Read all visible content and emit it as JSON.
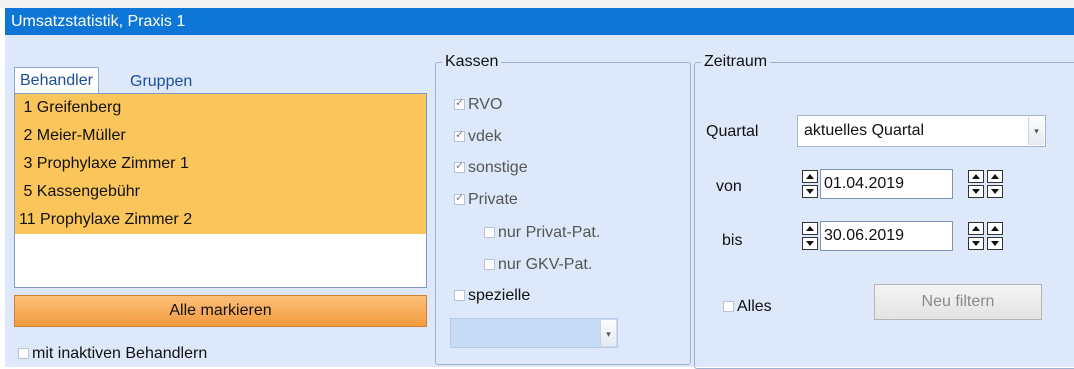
{
  "window": {
    "title": "Umsatzstatistik, Praxis 1"
  },
  "behandler": {
    "tabs": [
      "Behandler",
      "Gruppen"
    ],
    "items": [
      " 1 Greifenberg",
      " 2 Meier-Müller",
      " 3 Prophylaxe Zimmer 1",
      " 5 Kassengebühr",
      "11 Prophylaxe Zimmer 2"
    ],
    "select_all_label": "Alle markieren",
    "inactive_label": "mit inaktiven Behandlern"
  },
  "kassen": {
    "title": "Kassen",
    "options": [
      {
        "label": "RVO",
        "checked": true
      },
      {
        "label": "vdek",
        "checked": true
      },
      {
        "label": "sonstige",
        "checked": true
      },
      {
        "label": "Private",
        "checked": true
      }
    ],
    "sub_options": [
      "nur Privat-Pat.",
      "nur GKV-Pat."
    ],
    "spezielle_label": "spezielle"
  },
  "zeitraum": {
    "title": "Zeitraum",
    "quartal_label": "Quartal",
    "quartal_value": "aktuelles Quartal",
    "von_label": "von",
    "von_value": "01.04.2019",
    "bis_label": "bis",
    "bis_value": "30.06.2019",
    "alles_label": "Alles",
    "filter_button": "Neu filtern"
  },
  "colors": {
    "title_bar": "#0e76d6",
    "panel_bg": "#dde9fa",
    "selection": "#fac55a",
    "orange_button": "#f39b3f"
  }
}
